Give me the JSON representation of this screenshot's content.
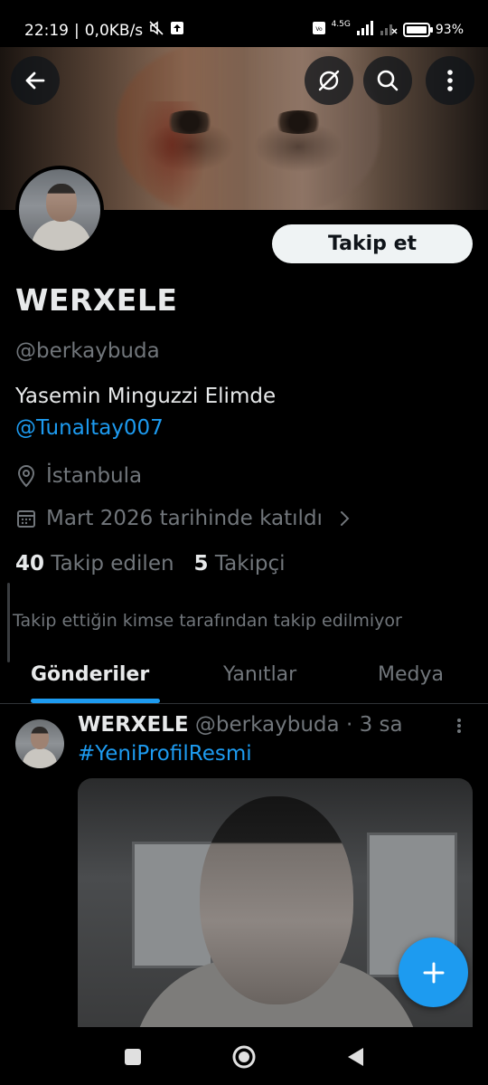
{
  "status_bar": {
    "time": "22:19",
    "net_speed": "0,0KB/s",
    "network": "4.5G",
    "battery": "93%",
    "icons": [
      "mute-icon",
      "upload-icon",
      "volte-icon",
      "signal-icon",
      "wifi-off-icon",
      "battery-icon"
    ]
  },
  "header": {
    "back_icon": "back-arrow-icon",
    "grok_icon": "grok-icon",
    "search_icon": "search-icon",
    "more_icon": "more-vertical-icon"
  },
  "profile": {
    "display_name": "WERXELE",
    "handle": "@berkaybuda",
    "follow_label": "Takip et",
    "bio": "Yasemin Minguzzi Elimde",
    "bio_mention": "@Tunaltay007",
    "location": "İstanbula",
    "joined": "Mart 2026 tarihinde katıldı",
    "following_count": "40",
    "following_label": "Takip edilen",
    "followers_count": "5",
    "followers_label": "Takipçi",
    "not_followed_note": "Takip ettiğin kimse tarafından takip edilmiyor"
  },
  "tabs": [
    {
      "label": "Gönderiler",
      "active": true
    },
    {
      "label": "Yanıtlar",
      "active": false
    },
    {
      "label": "Medya",
      "active": false
    }
  ],
  "post": {
    "author": "WERXELE",
    "handle": "@berkaybuda",
    "separator": "·",
    "time": "3 sa",
    "text": "#YeniProfilResmi"
  },
  "fab": {
    "icon": "plus-icon"
  },
  "nav": [
    "recent-apps-icon",
    "home-icon",
    "back-icon"
  ],
  "colors": {
    "accent": "#1d9bf0",
    "background": "#000000",
    "muted": "#71767b",
    "text": "#e7e9ea"
  }
}
